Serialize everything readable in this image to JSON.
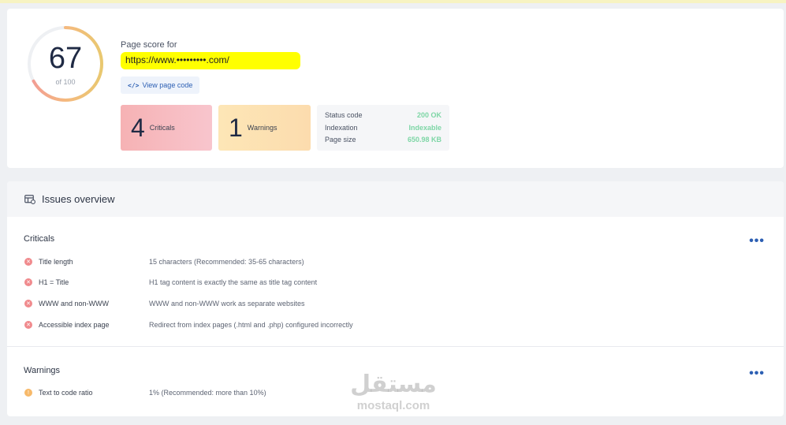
{
  "score": {
    "value": "67",
    "of": "of 100",
    "fraction": 0.67,
    "label": "Page score for",
    "url": "https://www.•••••••••.com/",
    "view_code": "View page code"
  },
  "summary": {
    "criticals_count": "4",
    "criticals_label": "Criticals",
    "warnings_count": "1",
    "warnings_label": "Warnings"
  },
  "status": [
    {
      "key": "Status code",
      "value": "200 OK"
    },
    {
      "key": "Indexation",
      "value": "Indexable"
    },
    {
      "key": "Page size",
      "value": "650.98 KB"
    }
  ],
  "issues": {
    "title": "Issues overview",
    "criticals_title": "Criticals",
    "warnings_title": "Warnings",
    "criticals": [
      {
        "name": "Title length",
        "desc": "15 characters (Recommended: 35-65 characters)"
      },
      {
        "name": "H1 = Title",
        "desc": "H1 tag content is exactly the same as title tag content"
      },
      {
        "name": "WWW and non-WWW",
        "desc": "WWW and non-WWW work as separate websites"
      },
      {
        "name": "Accessible index page",
        "desc": "Redirect from index pages (.html and .php) configured incorrectly"
      }
    ],
    "warnings": [
      {
        "name": "Text to code ratio",
        "desc": "1%   (Recommended: more than 10%)"
      }
    ],
    "more": "•••"
  },
  "watermark": {
    "arabic": "مستقل",
    "latin": "mostaql.com"
  },
  "colors": {
    "critical": "#f08a8d",
    "warning": "#f7b96a",
    "ok": "#7ed6a6",
    "accent": "#2c5fb3"
  }
}
